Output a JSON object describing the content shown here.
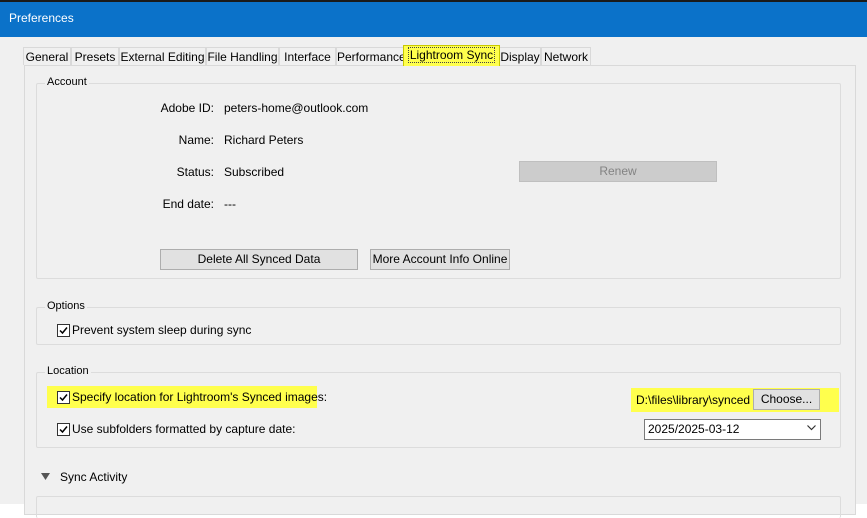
{
  "window": {
    "title": "Preferences"
  },
  "tabs": [
    {
      "label": "General"
    },
    {
      "label": "Presets"
    },
    {
      "label": "External Editing"
    },
    {
      "label": "File Handling"
    },
    {
      "label": "Interface"
    },
    {
      "label": "Performance"
    },
    {
      "label": "Lightroom Sync",
      "active": true
    },
    {
      "label": "Display"
    },
    {
      "label": "Network"
    }
  ],
  "account": {
    "group_label": "Account",
    "adobe_id_label": "Adobe ID:",
    "adobe_id": "peters-home@outlook.com",
    "name_label": "Name:",
    "name": "Richard Peters",
    "status_label": "Status:",
    "status": "Subscribed",
    "end_date_label": "End date:",
    "end_date": "---",
    "renew_button": "Renew",
    "delete_button": "Delete All Synced Data",
    "more_info_button": "More Account Info Online"
  },
  "options": {
    "group_label": "Options",
    "prevent_sleep_label": "Prevent system sleep during sync",
    "prevent_sleep_checked": true
  },
  "location": {
    "group_label": "Location",
    "specify_label": "Specify location for Lightroom's Synced images:",
    "specify_checked": true,
    "path": "D:\\files\\library\\synced",
    "choose_button": "Choose...",
    "subfolders_label": "Use subfolders formatted by capture date:",
    "subfolders_checked": true,
    "date_format": "2025/2025-03-12"
  },
  "sync_activity": {
    "label": "Sync Activity"
  },
  "colors": {
    "titlebar": "#0b72c9",
    "highlight": "#ffff4d"
  }
}
